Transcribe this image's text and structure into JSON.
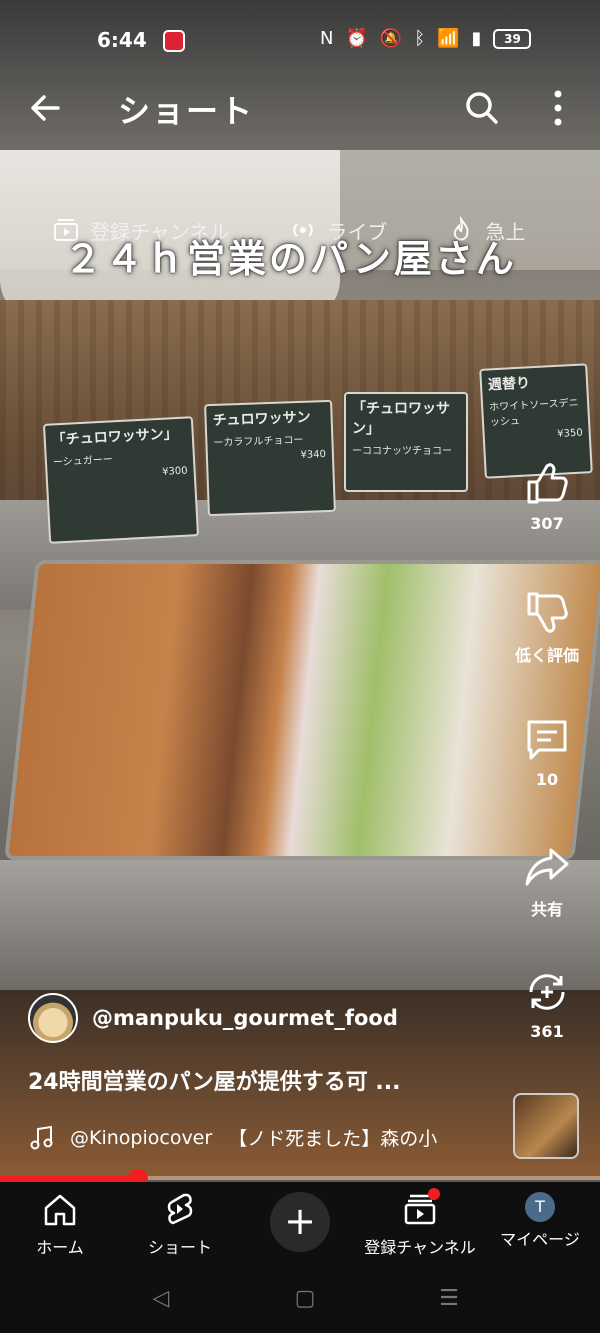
{
  "status_bar": {
    "time": "6:44",
    "battery": "39"
  },
  "header": {
    "title": "ショート",
    "back_icon": "arrow-left-icon",
    "search_icon": "search-icon",
    "more_icon": "more-vertical-icon"
  },
  "sub_nav": {
    "items": [
      {
        "label": "登録チャンネル",
        "icon": "subscriptions-icon"
      },
      {
        "label": "ライブ",
        "icon": "live-icon"
      },
      {
        "label": "急上",
        "icon": "trending-icon"
      }
    ]
  },
  "video": {
    "caption": "２４ｈ営業のパン屋さん",
    "signs": [
      {
        "title": "「チュロワッサン」",
        "sub": "ーシュガーー",
        "price": "¥300"
      },
      {
        "title": "チュロワッサン",
        "sub": "ーカラフルチョコー",
        "price": "¥340"
      },
      {
        "title": "「チュロワッサン」",
        "sub": "ーココナッツチョコー",
        "price": ""
      },
      {
        "title": "週替り",
        "sub": "ホワイトソースデニッシュ",
        "price": "¥350"
      }
    ]
  },
  "actions": {
    "like_count": "307",
    "dislike_label": "低く評価",
    "comment_count": "10",
    "share_label": "共有",
    "remix_count": "361"
  },
  "channel": {
    "name": "@manpuku_gourmet_food"
  },
  "video_title": "24時間営業のパン屋が提供する可 ...",
  "music": {
    "artist": "@Kinopiocover",
    "track": "【ノド死ました】森の小"
  },
  "progress": {
    "fraction": 0.23
  },
  "bottom_nav": {
    "home": "ホーム",
    "shorts": "ショート",
    "subscriptions": "登録チャンネル",
    "mypage": "マイページ",
    "profile_initial": "T"
  }
}
